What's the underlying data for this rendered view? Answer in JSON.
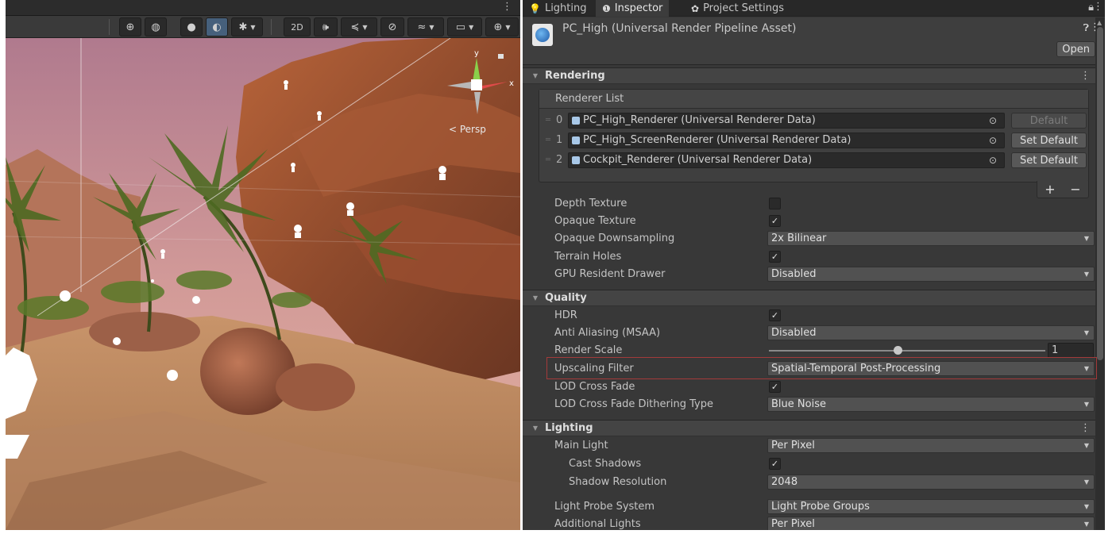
{
  "scene": {
    "persp_label": "< Persp",
    "axis_y": "y",
    "axis_x": "x",
    "toolbar": {
      "btn_2d": "2D"
    }
  },
  "tabs": [
    {
      "label": "Lighting",
      "icon": "bulb-icon"
    },
    {
      "label": "Inspector",
      "icon": "info-icon"
    },
    {
      "label": "Project Settings",
      "icon": "gear-icon"
    }
  ],
  "asset": {
    "title": "PC_High (Universal Render Pipeline Asset)",
    "open_label": "Open"
  },
  "rendering": {
    "header": "Rendering",
    "renderer_list": {
      "header": "Renderer List",
      "rows": [
        {
          "index": "0",
          "name": "PC_High_Renderer (Universal Renderer Data)",
          "button": "Default",
          "enabled": false
        },
        {
          "index": "1",
          "name": "PC_High_ScreenRenderer (Universal Renderer Data)",
          "button": "Set Default",
          "enabled": true
        },
        {
          "index": "2",
          "name": "Cockpit_Renderer (Universal Renderer Data)",
          "button": "Set Default",
          "enabled": true
        }
      ],
      "add": "+",
      "remove": "−"
    },
    "props": {
      "depth_texture": {
        "label": "Depth Texture",
        "checked": false
      },
      "opaque_texture": {
        "label": "Opaque Texture",
        "checked": true
      },
      "opaque_downsampling": {
        "label": "Opaque Downsampling",
        "value": "2x Bilinear"
      },
      "terrain_holes": {
        "label": "Terrain Holes",
        "checked": true
      },
      "gpu_resident_drawer": {
        "label": "GPU Resident Drawer",
        "value": "Disabled"
      }
    }
  },
  "quality": {
    "header": "Quality",
    "props": {
      "hdr": {
        "label": "HDR",
        "checked": true
      },
      "anti_aliasing": {
        "label": "Anti Aliasing (MSAA)",
        "value": "Disabled"
      },
      "render_scale": {
        "label": "Render Scale",
        "value": "1",
        "slider_fraction": 0.46
      },
      "upscaling_filter": {
        "label": "Upscaling Filter",
        "value": "Spatial-Temporal Post-Processing"
      },
      "lod_cross_fade": {
        "label": "LOD Cross Fade",
        "checked": true
      },
      "lod_dither": {
        "label": "LOD Cross Fade Dithering Type",
        "value": "Blue Noise"
      }
    }
  },
  "lighting": {
    "header": "Lighting",
    "props": {
      "main_light": {
        "label": "Main Light",
        "value": "Per Pixel"
      },
      "cast_shadows": {
        "label": "Cast Shadows",
        "checked": true
      },
      "shadow_resolution": {
        "label": "Shadow Resolution",
        "value": "2048"
      },
      "light_probe_system": {
        "label": "Light Probe System",
        "value": "Light Probe Groups"
      },
      "additional_lights": {
        "label": "Additional Lights",
        "value": "Per Pixel"
      }
    }
  },
  "colors": {
    "highlight_border": "#a33a3a",
    "active_tool": "#46607c"
  }
}
